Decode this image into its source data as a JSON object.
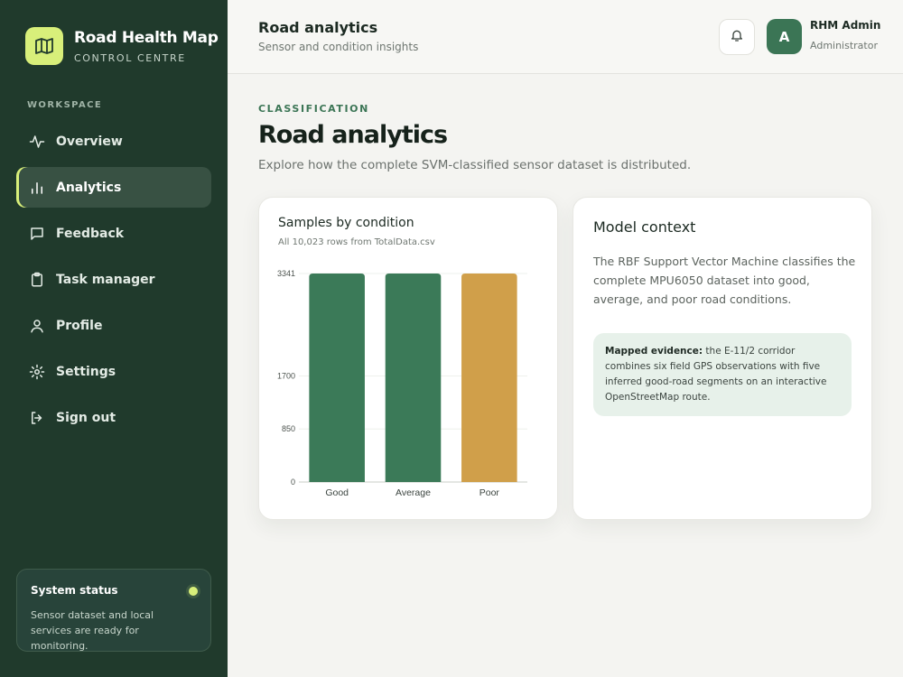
{
  "brand": {
    "name": "Road Health Map",
    "subtitle": "CONTROL CENTRE"
  },
  "sidebar": {
    "section_label": "WORKSPACE",
    "items": [
      {
        "label": "Overview",
        "icon": "activity-icon",
        "active": false
      },
      {
        "label": "Analytics",
        "icon": "bar-chart-icon",
        "active": true
      },
      {
        "label": "Feedback",
        "icon": "message-icon",
        "active": false
      },
      {
        "label": "Task manager",
        "icon": "clipboard-icon",
        "active": false
      },
      {
        "label": "Profile",
        "icon": "user-icon",
        "active": false
      },
      {
        "label": "Settings",
        "icon": "gear-icon",
        "active": false
      },
      {
        "label": "Sign out",
        "icon": "logout-icon",
        "active": false
      }
    ],
    "status": {
      "title": "System status",
      "text": "Sensor dataset and local services are ready for monitoring."
    }
  },
  "header": {
    "title": "Road analytics",
    "subtitle": "Sensor and condition insights",
    "user": {
      "initial": "A",
      "name": "RHM Admin",
      "role": "Administrator"
    }
  },
  "main": {
    "eyebrow": "CLASSIFICATION",
    "title": "Road analytics",
    "description": "Explore how the complete SVM-classified sensor dataset is distributed."
  },
  "chart_card": {
    "title": "Samples by condition",
    "subtitle": "All 10,023 rows from TotalData.csv"
  },
  "chart_data": {
    "type": "bar",
    "categories": [
      "Good",
      "Average",
      "Poor"
    ],
    "values": [
      3341,
      3341,
      3341
    ],
    "colors": [
      "#3b7a58",
      "#3b7a58",
      "#d09f4a"
    ],
    "yticks": [
      0,
      850,
      1700,
      3341
    ],
    "ylim": [
      0,
      3341
    ],
    "grid": true
  },
  "context_card": {
    "title": "Model context",
    "body": "The RBF Support Vector Machine classifies the complete MPU6050 dataset into good, average, and poor road conditions.",
    "evidence_label": "Mapped evidence:",
    "evidence_text": " the E-11/2 corridor combines six field GPS observations with five inferred good-road segments on an interactive OpenStreetMap route."
  },
  "colors": {
    "sidebar": "#203a2c",
    "accent": "#d8ef7a",
    "primary": "#3b7555",
    "warning": "#d09f4a"
  }
}
